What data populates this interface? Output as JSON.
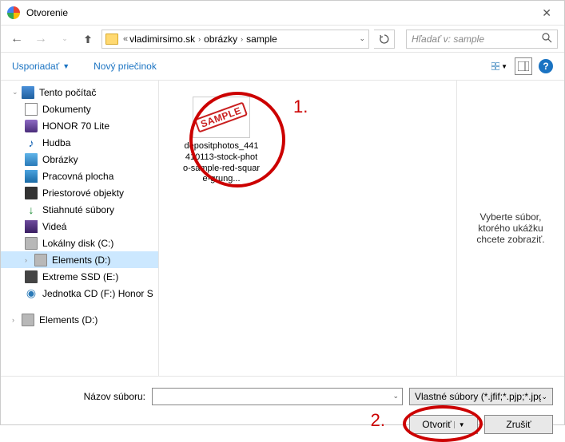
{
  "dialog": {
    "title": "Otvorenie"
  },
  "breadcrumb": {
    "parts": [
      "vladimirsimo.sk",
      "obrázky",
      "sample"
    ]
  },
  "search": {
    "placeholder": "Hľadať v: sample"
  },
  "toolbar": {
    "organize": "Usporiadať",
    "new_folder": "Nový priečinok"
  },
  "tree": {
    "pc": "Tento počítač",
    "documents": "Dokumenty",
    "phone": "HONOR 70 Lite",
    "music": "Hudba",
    "pictures": "Obrázky",
    "desktop": "Pracovná plocha",
    "objects3d": "Priestorové objekty",
    "downloads": "Stiahnuté súbory",
    "videos": "Videá",
    "local_c": "Lokálny disk (C:)",
    "elements_d": "Elements (D:)",
    "extreme_ssd": "Extreme SSD (E:)",
    "cd_drive": "Jednotka CD (F:) Honor S",
    "elements_d_2": "Elements (D:)"
  },
  "files": {
    "item1": {
      "thumb_text": "SAMPLE",
      "name": "depositphotos_441410113-stock-photo-sample-red-square-grung..."
    }
  },
  "preview": {
    "hint": "Vyberte súbor, ktorého ukážku chcete zobraziť."
  },
  "footer": {
    "filename_label": "Názov súboru:",
    "filter": "Vlastné súbory (*.jfif;*.pjp;*.jpg;",
    "open": "Otvoriť",
    "cancel": "Zrušiť"
  },
  "annotations": {
    "n1": "1.",
    "n2": "2."
  }
}
